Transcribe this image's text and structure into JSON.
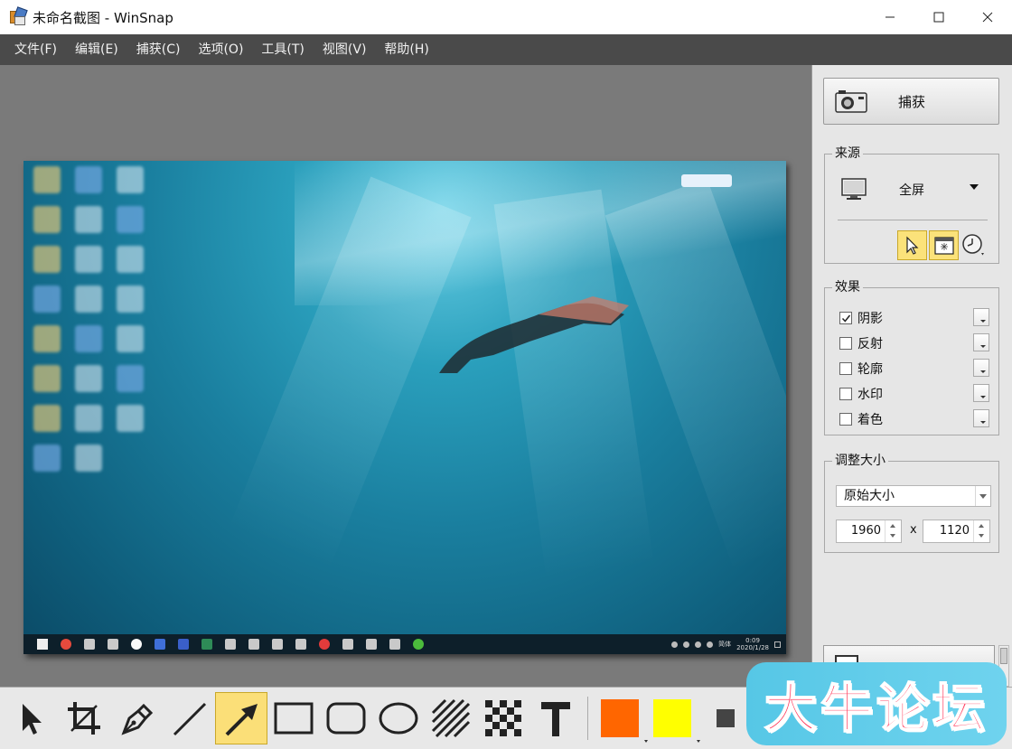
{
  "window": {
    "title": "未命名截图 - WinSnap"
  },
  "menu": {
    "items": [
      "文件(F)",
      "编辑(E)",
      "捕获(C)",
      "选项(O)",
      "工具(T)",
      "视图(V)",
      "帮助(H)"
    ]
  },
  "capture": {
    "label": "捕获"
  },
  "source": {
    "title": "来源",
    "value": "全屏"
  },
  "effects": {
    "title": "效果",
    "items": [
      {
        "label": "阴影",
        "checked": true
      },
      {
        "label": "反射",
        "checked": false
      },
      {
        "label": "轮廓",
        "checked": false
      },
      {
        "label": "水印",
        "checked": false
      },
      {
        "label": "着色",
        "checked": false
      }
    ]
  },
  "resize": {
    "title": "调整大小",
    "mode": "原始大小",
    "width": "1960",
    "height": "1120",
    "separator": "x"
  },
  "screenshot": {
    "clock_time": "0:09",
    "clock_date": "2020/1/28",
    "tray_lang": "简体"
  },
  "toolbar": {
    "colors": {
      "primary": "#ff6600",
      "secondary": "#ffff00"
    }
  },
  "watermark": {
    "text": "大牛论坛"
  }
}
